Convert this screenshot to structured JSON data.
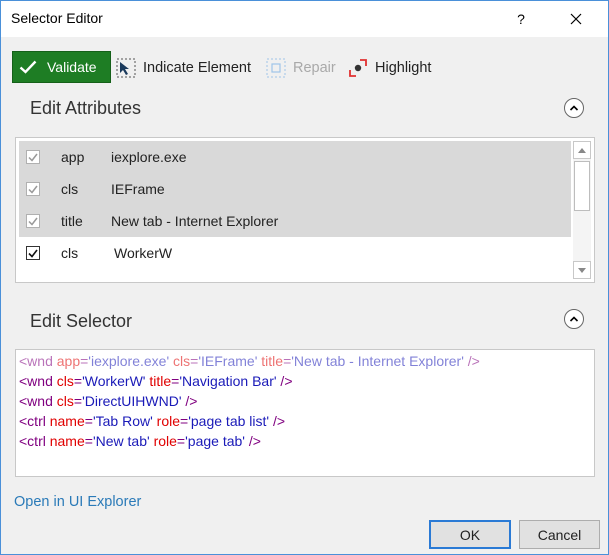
{
  "window": {
    "title": "Selector Editor",
    "help": "?",
    "close": "✕"
  },
  "toolbar": {
    "validate": "Validate",
    "indicate": "Indicate Element",
    "repair": "Repair",
    "highlight": "Highlight"
  },
  "attributes": {
    "title": "Edit Attributes",
    "rows": [
      {
        "name": "app",
        "value": "iexplore.exe",
        "checked": true
      },
      {
        "name": "cls",
        "value": "IEFrame",
        "checked": true
      },
      {
        "name": "title",
        "value": "New tab - Internet Explorer",
        "checked": true
      },
      {
        "name": "cls",
        "value": "WorkerW",
        "checked": true
      }
    ]
  },
  "selector": {
    "title": "Edit Selector",
    "lines": [
      {
        "tag": "wnd",
        "attrs": [
          [
            "app",
            "'iexplore.exe'"
          ],
          [
            "cls",
            "'IEFrame'"
          ],
          [
            "title",
            "'New tab - Internet Explorer'"
          ]
        ],
        "dim": true
      },
      {
        "tag": "wnd",
        "attrs": [
          [
            "cls",
            "'WorkerW'"
          ],
          [
            "title",
            "'Navigation Bar'"
          ]
        ],
        "dim": false
      },
      {
        "tag": "wnd",
        "attrs": [
          [
            "cls",
            "'DirectUIHWND'"
          ]
        ],
        "dim": false
      },
      {
        "tag": "ctrl",
        "attrs": [
          [
            "name",
            "'Tab Row'"
          ],
          [
            "role",
            "'page tab list'"
          ]
        ],
        "dim": false
      },
      {
        "tag": "ctrl",
        "attrs": [
          [
            "name",
            "'New tab'"
          ],
          [
            "role",
            "'page tab'"
          ]
        ],
        "dim": false
      }
    ]
  },
  "footer": {
    "open_link": "Open in UI Explorer",
    "ok": "OK",
    "cancel": "Cancel"
  },
  "colors": {
    "accent": "#1e7d24",
    "link": "#2a7ab8",
    "selection": "#d9d9d9"
  }
}
